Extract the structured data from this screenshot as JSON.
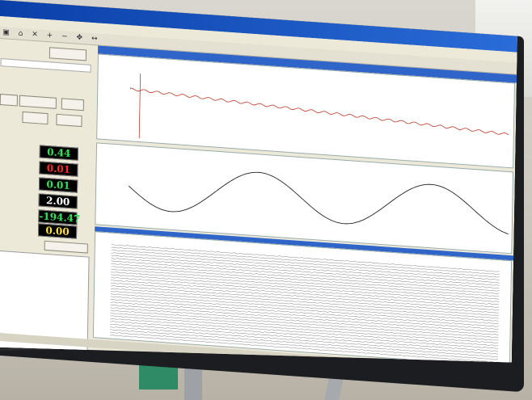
{
  "window": {
    "title": ""
  },
  "menu": [
    "",
    "",
    "",
    "",
    "",
    ""
  ],
  "toolbar": {
    "icons": [
      "save-icon",
      "open-icon",
      "close-icon",
      "plus-icon",
      "minus-icon",
      "move-icon",
      "arrow-icon"
    ]
  },
  "left_panel": {
    "buttons": [
      "",
      "",
      "",
      "",
      "",
      ""
    ],
    "labels": [
      "",
      "",
      "",
      "",
      "",
      ""
    ],
    "values": [
      "0.44",
      "0.01",
      "0.01",
      "2.00",
      "-194.47",
      "0.00"
    ],
    "value_colors": [
      "#2ee65a",
      "#ff2a2a",
      "#2ee65a",
      "#ffffff",
      "#2ee65a",
      "#ffe23a"
    ],
    "bottom_button": ""
  },
  "charts": {
    "top": {
      "caption": ""
    },
    "middle": {
      "caption": ""
    },
    "bottom": {
      "caption": ""
    }
  }
}
